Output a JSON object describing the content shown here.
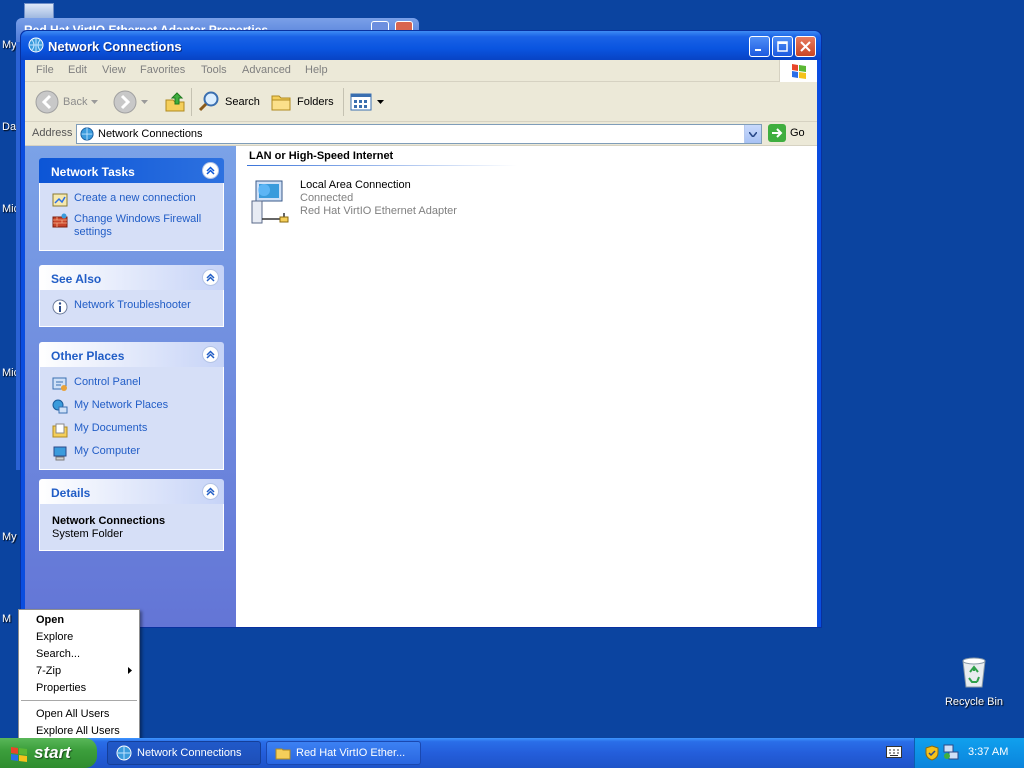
{
  "desktop": {
    "labels": [
      "My",
      "Da",
      "Mic",
      "Mic",
      "My I",
      "M"
    ],
    "recycle_bin": "Recycle Bin"
  },
  "background_window": {
    "title": "Red Hat VirtIO Ethernet Adapter Properties"
  },
  "window": {
    "title": "Network Connections",
    "menu": [
      "File",
      "Edit",
      "View",
      "Favorites",
      "Tools",
      "Advanced",
      "Help"
    ],
    "toolbar": {
      "back": "Back",
      "search": "Search",
      "folders": "Folders"
    },
    "address": {
      "label": "Address",
      "value": "Network Connections",
      "go": "Go"
    },
    "left_panels": {
      "network_tasks": {
        "title": "Network Tasks",
        "items": [
          "Create a new connection",
          "Change Windows Firewall settings"
        ]
      },
      "see_also": {
        "title": "See Also",
        "items": [
          "Network Troubleshooter"
        ]
      },
      "other_places": {
        "title": "Other Places",
        "items": [
          "Control Panel",
          "My Network Places",
          "My Documents",
          "My Computer"
        ]
      },
      "details": {
        "title": "Details",
        "name": "Network Connections",
        "type": "System Folder"
      }
    },
    "group_heading": "LAN or High-Speed Internet",
    "connection": {
      "name": "Local Area Connection",
      "status": "Connected",
      "device": "Red Hat VirtIO Ethernet Adapter"
    }
  },
  "context_menu": {
    "items": [
      "Open",
      "Explore",
      "Search...",
      "7-Zip",
      "Properties"
    ],
    "items_after_separator": [
      "Open All Users",
      "Explore All Users"
    ]
  },
  "taskbar": {
    "start": "start",
    "buttons": [
      "Network Connections",
      "Red Hat VirtIO Ether..."
    ],
    "clock": "3:37 AM"
  }
}
